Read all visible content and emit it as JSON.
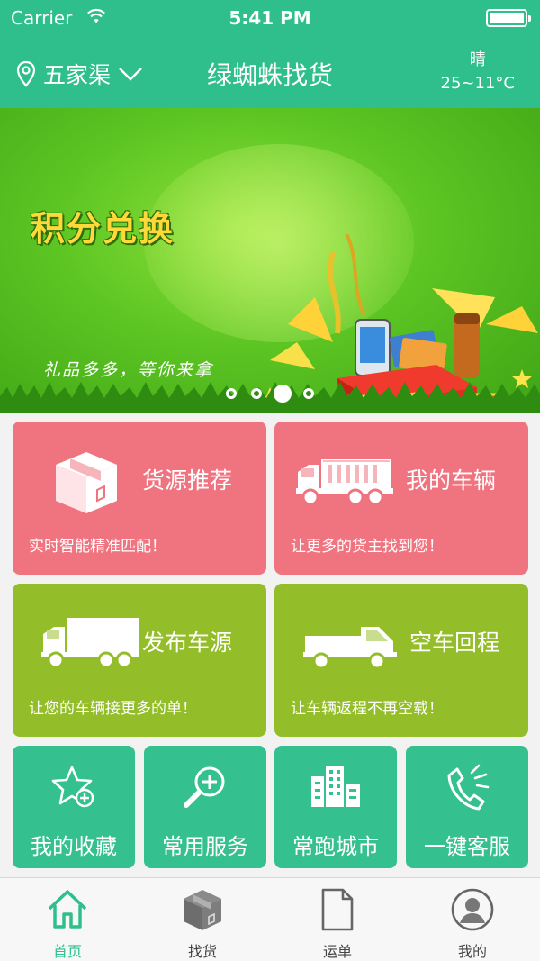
{
  "status_bar": {
    "carrier": "Carrier",
    "time": "5:41 PM"
  },
  "header": {
    "location": "五家渠",
    "title": "绿蜘蛛找货",
    "weather_condition": "晴",
    "weather_temp": "25~11°C"
  },
  "banner": {
    "headline": "积分兑换",
    "subtitle": "礼品多多，等你来拿",
    "slide_count": 4,
    "active_slide": 3
  },
  "cards": [
    {
      "label": "货源推荐",
      "desc": "实时智能精准匹配！",
      "icon": "package-box-icon",
      "color": "#f07480"
    },
    {
      "label": "我的车辆",
      "desc": "让更多的货主找到您！",
      "icon": "dump-truck-icon",
      "color": "#f07480"
    },
    {
      "label": "发布车源",
      "desc": "让您的车辆接更多的单！",
      "icon": "box-truck-icon",
      "color": "#94bd2a"
    },
    {
      "label": "空车回程",
      "desc": "让车辆返程不再空载！",
      "icon": "pickup-truck-icon",
      "color": "#94bd2a"
    }
  ],
  "quick": [
    {
      "label": "我的收藏",
      "icon": "star-plus-icon"
    },
    {
      "label": "常用服务",
      "icon": "search-plus-icon"
    },
    {
      "label": "常跑城市",
      "icon": "city-buildings-icon"
    },
    {
      "label": "一键客服",
      "icon": "phone-call-icon"
    }
  ],
  "tabs": [
    {
      "label": "首页",
      "icon": "home-icon",
      "active": true
    },
    {
      "label": "找货",
      "icon": "package-icon",
      "active": false
    },
    {
      "label": "运单",
      "icon": "document-icon",
      "active": false
    },
    {
      "label": "我的",
      "icon": "user-avatar-icon",
      "active": false
    }
  ],
  "colors": {
    "brand": "#2fbf8c",
    "pink": "#f07480",
    "olive": "#94bd2a",
    "teal": "#35c08f"
  }
}
